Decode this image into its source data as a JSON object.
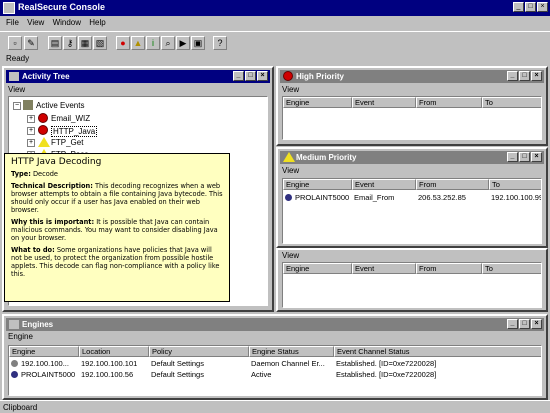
{
  "app": {
    "title": "RealSecure Console"
  },
  "menu": [
    "File",
    "View",
    "Window",
    "Help"
  ],
  "toolbar": {
    "status": "Ready"
  },
  "activity_tree": {
    "title": "Activity Tree",
    "menu": "View",
    "root": "Active Events",
    "items": [
      {
        "label": "Email_WIZ",
        "icon": "stop-icon"
      },
      {
        "label": "HTTP_Java",
        "icon": "stop-icon"
      },
      {
        "label": "FTP_Get",
        "icon": "warning-icon"
      },
      {
        "label": "FTP_Pass",
        "icon": "warning-icon"
      }
    ]
  },
  "tooltip": {
    "title": "HTTP Java Decoding",
    "type_label": "Type:",
    "type_value": "Decode",
    "tech_label": "Technical Description:",
    "tech_text": "This decoding recognizes when a web browser attempts to obtain a file containing Java bytecode. This should only occur if a user has Java enabled on their web browser.",
    "why_label": "Why this is important:",
    "why_text": "It is possible that Java can contain malicious commands. You may want to consider disabling Java on your browser.",
    "what_label": "What to do:",
    "what_text": "Some organizations have policies that Java will not be used, to protect the organization from possible hostile applets. This decode can flag non-compliance with a policy like this."
  },
  "high_priority": {
    "title": "High Priority",
    "menu": "View",
    "columns": [
      "Engine",
      "Event",
      "From",
      "To"
    ]
  },
  "medium_priority": {
    "title": "Medium Priority",
    "menu": "View",
    "columns": [
      "Engine",
      "Event",
      "From",
      "To"
    ],
    "rows": [
      {
        "engine": "PROLAINT5000",
        "event": "Email_From",
        "from": "206.53.252.85",
        "to": "192.100.100.99"
      }
    ]
  },
  "low_priority": {
    "menu": "View",
    "columns": [
      "Engine",
      "Event",
      "From",
      "To"
    ]
  },
  "engines": {
    "title": "Engines",
    "menu": "Engine",
    "columns": [
      "Engine",
      "Location",
      "Policy",
      "Engine Status",
      "Event Channel Status"
    ],
    "rows": [
      {
        "engine": "192.100.100...",
        "location": "192.100.100.101",
        "policy": "Default Settings",
        "status": "Daemon Channel Er...",
        "channel": "Established.  [ID=0xe7220028]"
      },
      {
        "engine": "PROLAINT5000",
        "location": "192.100.100.56",
        "policy": "Default Settings",
        "status": "Active",
        "channel": "Established.  [ID=0xe7220028]"
      }
    ]
  },
  "statusbar": {
    "text": "Clipboard"
  },
  "colors": {
    "title_active": "#000080",
    "title_inactive": "#808080",
    "tooltip_bg": "#ffffc0",
    "stop": "#d00000",
    "warning": "#f0e020"
  }
}
